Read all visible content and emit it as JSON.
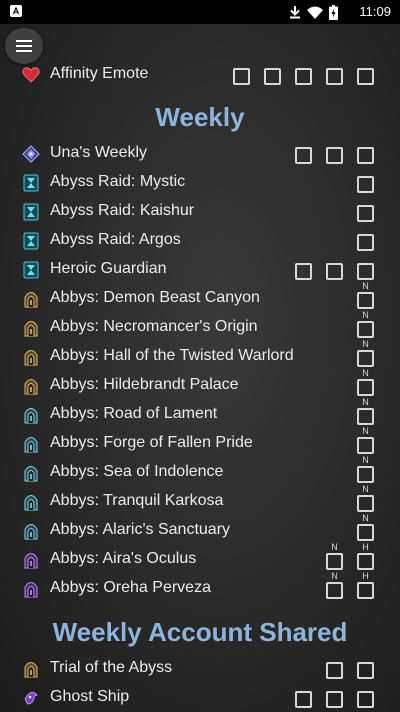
{
  "status_bar": {
    "badge": "A",
    "time": "11:09",
    "icons": [
      "download-icon",
      "wifi-icon",
      "battery-icon"
    ]
  },
  "menu": {
    "icon": "hamburger-menu-icon"
  },
  "colors": {
    "section_heading": "#8fb4dc",
    "background": "#2c2c2c",
    "checkbox": "#d8d8d8"
  },
  "top_item": {
    "label": "Affinity Emote",
    "icon": "heart-icon",
    "checkboxes": 5
  },
  "sections": [
    {
      "title": "Weekly",
      "items": [
        {
          "label": "Una's Weekly",
          "icon": "una-crest-icon",
          "checkboxes": 3,
          "tags": []
        },
        {
          "label": "Abyss Raid: Mystic",
          "icon": "abyss-raid-icon",
          "checkboxes": 1,
          "tags": []
        },
        {
          "label": "Abyss Raid: Kaishur",
          "icon": "abyss-raid-icon",
          "checkboxes": 1,
          "tags": []
        },
        {
          "label": "Abyss Raid: Argos",
          "icon": "abyss-raid-icon",
          "checkboxes": 1,
          "tags": []
        },
        {
          "label": "Heroic Guardian",
          "icon": "abyss-raid-icon",
          "checkboxes": 3,
          "tags": []
        },
        {
          "label": "Abbys: Demon Beast Canyon",
          "icon": "abyss-dungeon-gold-icon",
          "checkboxes": 1,
          "tags": [
            "N"
          ]
        },
        {
          "label": "Abbys: Necromancer's Origin",
          "icon": "abyss-dungeon-gold-icon",
          "checkboxes": 1,
          "tags": [
            "N"
          ]
        },
        {
          "label": "Abbys: Hall of the Twisted Warlord",
          "icon": "abyss-dungeon-gold-icon",
          "checkboxes": 1,
          "tags": [
            "N"
          ]
        },
        {
          "label": "Abbys: Hildebrandt Palace",
          "icon": "abyss-dungeon-gold-icon",
          "checkboxes": 1,
          "tags": [
            "N"
          ]
        },
        {
          "label": "Abbys: Road of Lament",
          "icon": "abyss-dungeon-teal-icon",
          "checkboxes": 1,
          "tags": [
            "N"
          ]
        },
        {
          "label": "Abbys: Forge of Fallen Pride",
          "icon": "abyss-dungeon-teal-icon",
          "checkboxes": 1,
          "tags": [
            "N"
          ]
        },
        {
          "label": "Abbys: Sea of Indolence",
          "icon": "abyss-dungeon-teal-icon",
          "checkboxes": 1,
          "tags": [
            "N"
          ]
        },
        {
          "label": "Abbys: Tranquil Karkosa",
          "icon": "abyss-dungeon-teal-icon",
          "checkboxes": 1,
          "tags": [
            "N"
          ]
        },
        {
          "label": "Abbys: Alaric's Sanctuary",
          "icon": "abyss-dungeon-teal-icon",
          "checkboxes": 1,
          "tags": [
            "N"
          ]
        },
        {
          "label": "Abbys: Aira's Oculus",
          "icon": "abyss-dungeon-purple-icon",
          "checkboxes": 2,
          "tags": [
            "N",
            "H"
          ]
        },
        {
          "label": "Abbys: Oreha Perveza",
          "icon": "abyss-dungeon-purple-icon",
          "checkboxes": 2,
          "tags": [
            "N",
            "H"
          ]
        }
      ]
    },
    {
      "title": "Weekly Account Shared",
      "items": [
        {
          "label": "Trial of the Abyss",
          "icon": "abyss-dungeon-gold-icon",
          "checkboxes": 2,
          "tags": []
        },
        {
          "label": "Ghost Ship",
          "icon": "ghost-ship-icon",
          "checkboxes": 3,
          "tags": []
        }
      ]
    }
  ]
}
